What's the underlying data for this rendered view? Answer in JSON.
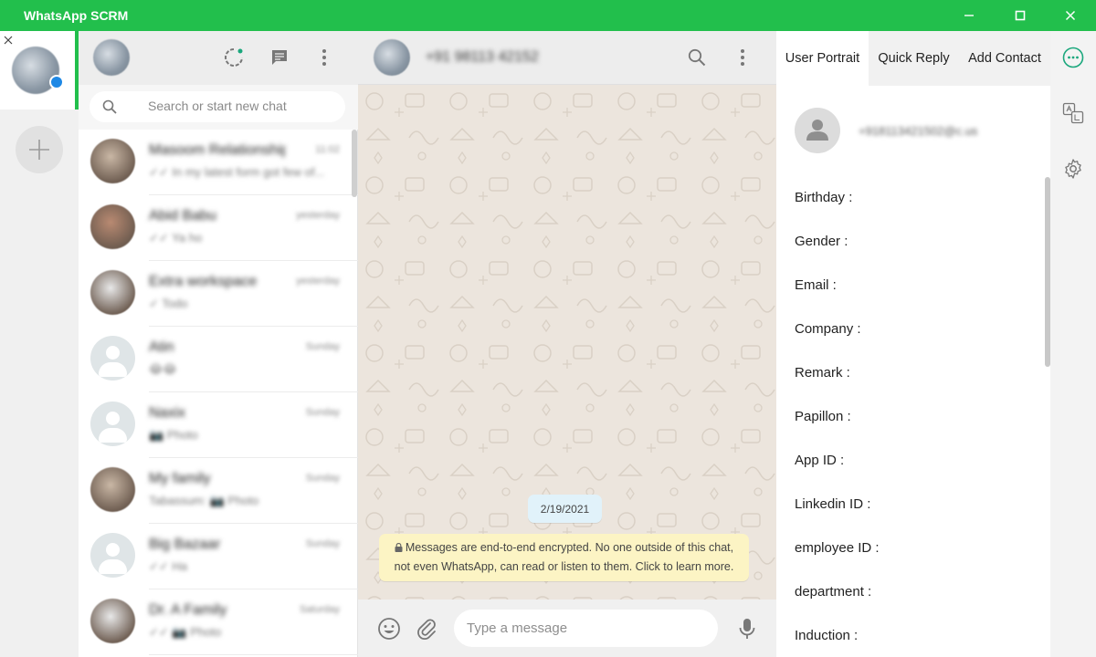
{
  "window": {
    "title": "WhatsApp SCRM",
    "colors": {
      "brand": "#22bf4c",
      "chat_bg": "#ece5dd"
    }
  },
  "chat_list": {
    "search_placeholder": "Search or start new chat",
    "chats": [
      {
        "name": "Masoom Relationship",
        "time": "11:02",
        "preview": "✓✓ In my latest form got few of...",
        "avatar": "photo"
      },
      {
        "name": "Abid Babu",
        "time": "yesterday",
        "preview": "✓✓ Ya ho",
        "avatar": "photo"
      },
      {
        "name": "Extra workspace",
        "time": "yesterday",
        "preview": "✓ Todo",
        "avatar": "photo"
      },
      {
        "name": "Atin",
        "time": "Sunday",
        "preview": "😂😂",
        "avatar": "default"
      },
      {
        "name": "Naxix",
        "time": "Sunday",
        "preview": "📷 Photo",
        "avatar": "default"
      },
      {
        "name": "My family",
        "time": "Sunday",
        "preview": "Tabassum: 📷 Photo",
        "avatar": "photo"
      },
      {
        "name": "Big Bazaar",
        "time": "Sunday",
        "preview": "✓✓ Ha",
        "avatar": "default"
      },
      {
        "name": "Dr. A Family",
        "time": "Saturday",
        "preview": "✓✓ 📷 Photo",
        "avatar": "photo"
      }
    ]
  },
  "conversation": {
    "contact_name": "+91 98113 42152",
    "date_chip": "2/19/2021",
    "encryption_notice": "Messages are end-to-end encrypted. No one outside of this chat, not even WhatsApp, can read or listen to them. Click to learn more.",
    "message_placeholder": "Type a message"
  },
  "profile_panel": {
    "tabs": [
      "User Portrait",
      "Quick Reply",
      "Add Contact"
    ],
    "contact_id": "+918113421502@c.us",
    "fields": [
      "Birthday :",
      "Gender :",
      "Email :",
      "Company :",
      "Remark :",
      "Papillon :",
      "App ID :",
      "Linkedin ID :",
      "employee ID :",
      "department :",
      "Induction :"
    ]
  }
}
